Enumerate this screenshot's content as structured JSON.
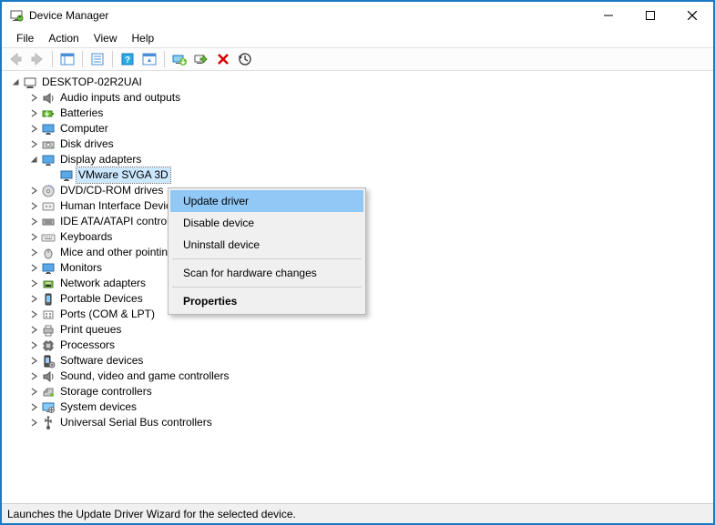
{
  "window": {
    "title": "Device Manager"
  },
  "menu": {
    "file": "File",
    "action": "Action",
    "view": "View",
    "help": "Help"
  },
  "tree": {
    "root": "DESKTOP-02R2UAI",
    "categories": [
      {
        "label": "Audio inputs and outputs",
        "icon": "speaker"
      },
      {
        "label": "Batteries",
        "icon": "battery"
      },
      {
        "label": "Computer",
        "icon": "monitor"
      },
      {
        "label": "Disk drives",
        "icon": "disk"
      },
      {
        "label": "Display adapters",
        "icon": "monitor",
        "expanded": true,
        "children": [
          {
            "label": "VMware SVGA 3D",
            "icon": "monitor",
            "selected": true
          }
        ]
      },
      {
        "label": "DVD/CD-ROM drives",
        "icon": "optical"
      },
      {
        "label": "Human Interface Devices",
        "icon": "hid"
      },
      {
        "label": "IDE ATA/ATAPI controllers",
        "icon": "ide"
      },
      {
        "label": "Keyboards",
        "icon": "keyboard"
      },
      {
        "label": "Mice and other pointing devices",
        "icon": "mouse"
      },
      {
        "label": "Monitors",
        "icon": "monitor"
      },
      {
        "label": "Network adapters",
        "icon": "network"
      },
      {
        "label": "Portable Devices",
        "icon": "portable"
      },
      {
        "label": "Ports (COM & LPT)",
        "icon": "port"
      },
      {
        "label": "Print queues",
        "icon": "printer"
      },
      {
        "label": "Processors",
        "icon": "cpu"
      },
      {
        "label": "Software devices",
        "icon": "software"
      },
      {
        "label": "Sound, video and game controllers",
        "icon": "speaker"
      },
      {
        "label": "Storage controllers",
        "icon": "storage"
      },
      {
        "label": "System devices",
        "icon": "system"
      },
      {
        "label": "Universal Serial Bus controllers",
        "icon": "usb"
      }
    ]
  },
  "context_menu": {
    "update": "Update driver",
    "disable": "Disable device",
    "uninstall": "Uninstall device",
    "scan": "Scan for hardware changes",
    "properties": "Properties"
  },
  "status": "Launches the Update Driver Wizard for the selected device."
}
